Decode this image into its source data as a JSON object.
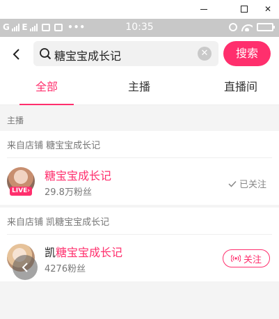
{
  "window": {
    "minimize_icon": "minimize-icon",
    "maximize_icon": "maximize-icon",
    "close_label": "✕"
  },
  "status_bar": {
    "carrier": "G",
    "network": "E",
    "dots": "•••",
    "time": "10:35"
  },
  "search": {
    "query": "糖宝宝成长记",
    "clear_label": "✕",
    "button_label": "搜索"
  },
  "tabs": [
    {
      "label": "全部",
      "active": true
    },
    {
      "label": "主播",
      "active": false
    },
    {
      "label": "直播间",
      "active": false
    }
  ],
  "section": {
    "label": "主播"
  },
  "results": [
    {
      "shop_line": "来自店铺 糖宝宝成长记",
      "name_prefix": "",
      "name_highlight": "糖宝宝成长记",
      "fans": "29.8万粉丝",
      "live_badge": "LIVE›",
      "action_label": "已关注",
      "followed": true
    },
    {
      "shop_line": "来自店铺 凯糖宝宝成长记",
      "name_prefix": "凯",
      "name_highlight": "糖宝宝成长记",
      "fans": "4276粉丝",
      "live_badge": "",
      "action_label": "关注",
      "followed": false
    }
  ],
  "colors": {
    "accent": "#ff2f6d",
    "status_bar_bg": "#c8c8c8",
    "page_bg": "#f4f4f4"
  }
}
